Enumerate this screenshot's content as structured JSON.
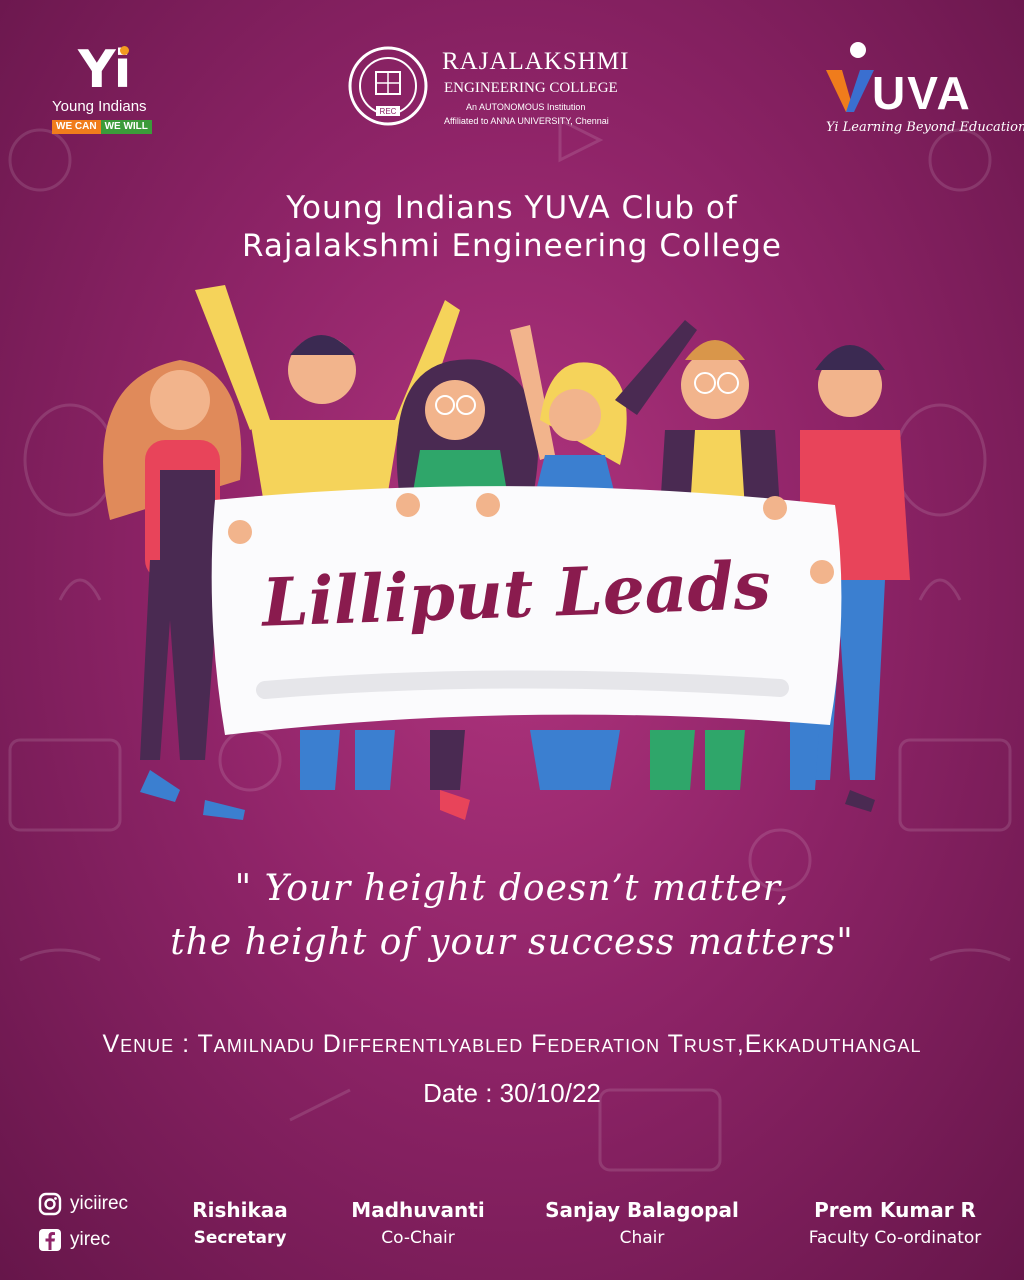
{
  "logos": {
    "yi": {
      "mark": "Yi",
      "name": "Young Indians",
      "tag_left": "WE CAN",
      "tag_right": "WE WILL"
    },
    "rec": {
      "seal_text": "REC",
      "title": "RAJALAKSHMI",
      "subtitle": "ENGINEERING COLLEGE",
      "autonomous": "An AUTONOMOUS Institution",
      "affiliation": "Affiliated to ANNA UNIVERSITY, Chennai"
    },
    "yuva": {
      "word": "UVA",
      "tagline": "Yi Learning Beyond Education"
    }
  },
  "heading": {
    "line1": "Young Indians YUVA Club of",
    "line2": "Rajalakshmi Engineering College"
  },
  "banner": {
    "title": "Lilliput Leads"
  },
  "quote": {
    "line1": "\" Your height doesn’t matter,",
    "line2": "the height of your success matters\""
  },
  "venue": "Venue : Tamilnadu  Differentlyabled  Federation Trust,Ekkaduthangal",
  "date": "Date : 30/10/22",
  "social": {
    "instagram": "yiciirec",
    "facebook": "yirec"
  },
  "people": [
    {
      "name": "Rishikaa",
      "role": "Secretary"
    },
    {
      "name": "Madhuvanti",
      "role": "Co-Chair"
    },
    {
      "name": "Sanjay Balagopal",
      "role": "Chair"
    },
    {
      "name": "Prem Kumar R",
      "role": "Faculty Co-ordinator"
    }
  ],
  "colors": {
    "background": "#8f2468",
    "banner_text": "#8a1b4e",
    "accent_orange": "#f07c1c",
    "accent_green": "#3b9b3a"
  }
}
